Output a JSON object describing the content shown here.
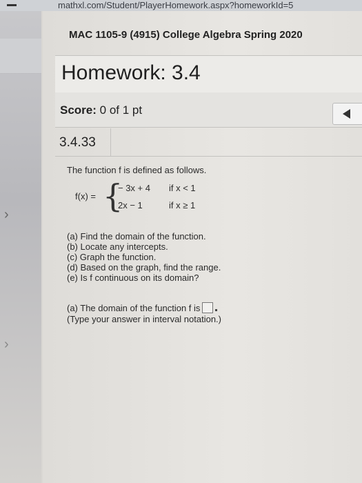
{
  "browser": {
    "url_fragment": "mathxl.com/Student/PlayerHomework.aspx?homeworkId=5"
  },
  "course": {
    "title": "MAC 1105-9 (4915) College Algebra Spring 2020"
  },
  "homework": {
    "title": "Homework: 3.4",
    "score_label": "Score:",
    "score_value": "0 of 1 pt"
  },
  "question": {
    "number": "3.4.33",
    "intro": "The function f is defined as follows.",
    "function_lhs": "f(x) =",
    "cases": [
      {
        "expression": "− 3x + 4",
        "condition": "if x < 1"
      },
      {
        "expression": "2x − 1",
        "condition": "if x ≥ 1"
      }
    ],
    "parts": [
      "(a) Find the domain of the function.",
      "(b) Locate any intercepts.",
      "(c) Graph the function.",
      "(d) Based on the graph, find the range.",
      "(e) Is f continuous on its domain?"
    ],
    "answer_prompt": "(a) The domain of the function f is",
    "answer_hint": "(Type your answer in interval notation.)",
    "answer_value": ""
  },
  "icons": [
    "chevron-right-icon",
    "chevron-right-icon",
    "back-arrow-icon"
  ]
}
